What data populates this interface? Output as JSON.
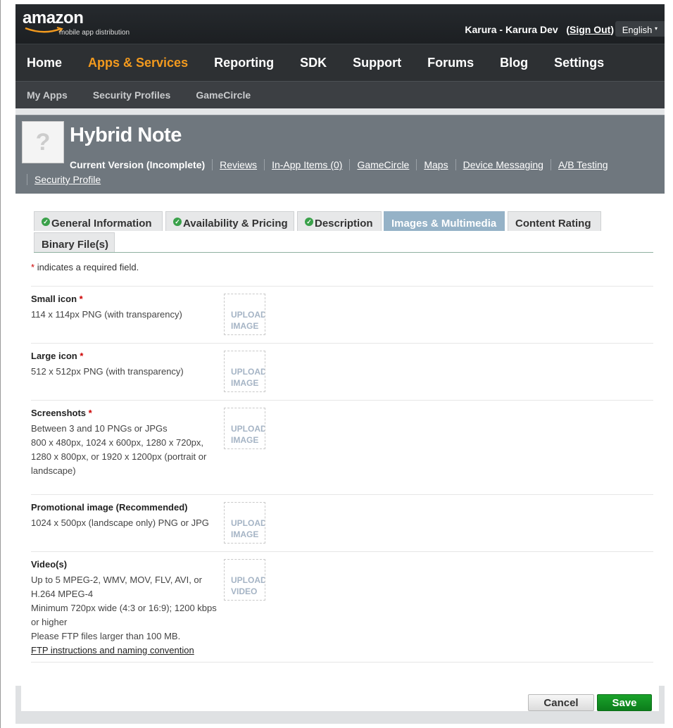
{
  "header": {
    "logo_text": "amazon",
    "logo_subtext": "mobile app distribution",
    "user_name": "Karura - Karura Dev",
    "sign_out_label": "Sign Out",
    "language": "English"
  },
  "main_nav": [
    "Home",
    "Apps & Services",
    "Reporting",
    "SDK",
    "Support",
    "Forums",
    "Blog",
    "Settings"
  ],
  "main_nav_active": "Apps & Services",
  "sub_nav": [
    "My Apps",
    "Security Profiles",
    "GameCircle"
  ],
  "app": {
    "icon_placeholder": "?",
    "title": "Hybrid Note",
    "current_version": "Current Version (Incomplete)",
    "links": [
      "Reviews",
      "In-App Items (0)",
      "GameCircle",
      "Maps",
      "Device Messaging",
      "A/B Testing",
      "Security Profile"
    ]
  },
  "tabs": [
    {
      "label": "General Information",
      "complete": true
    },
    {
      "label": "Availability & Pricing",
      "complete": true
    },
    {
      "label": "Description",
      "complete": true
    },
    {
      "label": "Images & Multimedia",
      "complete": false,
      "active": true
    },
    {
      "label": "Content Rating",
      "complete": false
    },
    {
      "label": "Binary File(s)",
      "complete": false
    }
  ],
  "required_note": "indicates a required field.",
  "required_mark": "*",
  "fields": [
    {
      "title": "Small icon",
      "required": true,
      "description": "114 x 114px PNG (with transparency)",
      "upload_label_1": "UPLOAD",
      "upload_label_2": "IMAGE"
    },
    {
      "title": "Large icon",
      "required": true,
      "description": "512 x 512px PNG (with transparency)",
      "upload_label_1": "UPLOAD",
      "upload_label_2": "IMAGE"
    },
    {
      "title": "Screenshots",
      "required": true,
      "description_lines": [
        "Between 3 and 10 PNGs or JPGs",
        "800 x 480px, 1024 x 600px, 1280 x 720px,",
        "1280 x 800px, or 1920 x 1200px (portrait or landscape)"
      ],
      "upload_label_1": "UPLOAD",
      "upload_label_2": "IMAGE"
    },
    {
      "title": "Promotional image (Recommended)",
      "required": false,
      "description": "1024 x 500px (landscape only) PNG or JPG",
      "upload_label_1": "UPLOAD",
      "upload_label_2": "IMAGE"
    },
    {
      "title": "Video(s)",
      "required": false,
      "description_lines": [
        "Up to 5 MPEG-2, WMV, MOV, FLV, AVI, or H.264 MPEG-4",
        "Minimum 720px wide (4:3 or 16:9); 1200 kbps or higher",
        "Please FTP files larger than 100 MB."
      ],
      "link": "FTP instructions and naming convention",
      "upload_label_1": "UPLOAD",
      "upload_label_2": "VIDEO"
    }
  ],
  "buttons": {
    "cancel": "Cancel",
    "save": "Save"
  },
  "colors": {
    "accent_orange": "#f39a1e",
    "active_tab": "#95b2c7",
    "save_green": "#1a9a2a",
    "required_red": "#cc0000",
    "check_green": "#3aa14a"
  }
}
